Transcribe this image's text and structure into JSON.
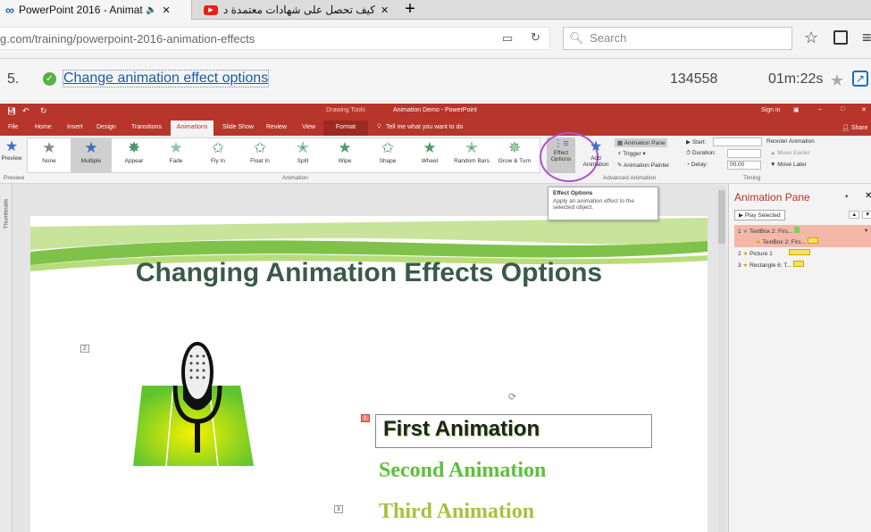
{
  "browser": {
    "tab1_title": "PowerPoint 2016 - Animat",
    "tab2_title": "كيف تحصل على شهادات معتمدة د",
    "new_tab": "+",
    "url": "g.com/training/powerpoint-2016-animation-effects",
    "search_placeholder": "Search"
  },
  "lesson": {
    "number": "5.",
    "title": "Change animation effect options",
    "views": "134558",
    "duration": "01m:22s"
  },
  "ppt": {
    "drawing_tools": "Drawing Tools",
    "doc_title": "Animation Demo - PowerPoint",
    "sign_in": "Sign in",
    "menu": [
      "File",
      "Home",
      "Insert",
      "Design",
      "Transitions",
      "Animations",
      "Slide Show",
      "Review",
      "View",
      "Format"
    ],
    "tell_me": "Tell me what you want to do",
    "share": "Share",
    "preview_label": "Preview",
    "preview_group": "Preview",
    "animations": [
      "None",
      "Multiple",
      "Appear",
      "Fade",
      "Fly In",
      "Float In",
      "Split",
      "Wipe",
      "Shape",
      "Wheel",
      "Random Bars",
      "Grow & Turn"
    ],
    "animation_group": "Animation",
    "effect_options": "Effect Options",
    "add_animation": "Add Animation",
    "animation_pane_btn": "Animation Pane",
    "trigger": "Trigger",
    "animation_painter": "Animation Painter",
    "advanced_group": "Advanced Animation",
    "start": "Start:",
    "duration": "Duration:",
    "duration_value": "",
    "delay": "Delay:",
    "delay_value": "00.00",
    "reorder": "Reorder Animation",
    "move_earlier": "Move Earlier",
    "move_later": "Move Later",
    "timing_group": "Timing",
    "tooltip_title": "Effect Options",
    "tooltip_body": "Apply an animation effect to the selected object.",
    "thumbnails": "Thumbnails",
    "pane_title": "Animation Pane",
    "play_selected": "Play Selected",
    "pane_items": [
      {
        "num": "1",
        "label": "TextBox 2: Firs..."
      },
      {
        "num": "",
        "label": "TextBox 2: Firs..."
      },
      {
        "num": "2",
        "label": "Picture 1"
      },
      {
        "num": "3",
        "label": "Rectangle 6: T..."
      }
    ]
  },
  "slide": {
    "title": "Changing Animation Effects Options",
    "text1": "First Animation",
    "text2": "Second Animation",
    "text3": "Third Animation",
    "tag1": "1",
    "tag2": "2",
    "tag3": "3"
  },
  "colors": {
    "ppt_red": "#b7352b",
    "slide_title": "#3a5a48",
    "green_text": "#5cbf3a",
    "yellow_text": "#a4c23c",
    "highlight": "#f4b7a8",
    "circle": "#b050d0"
  }
}
